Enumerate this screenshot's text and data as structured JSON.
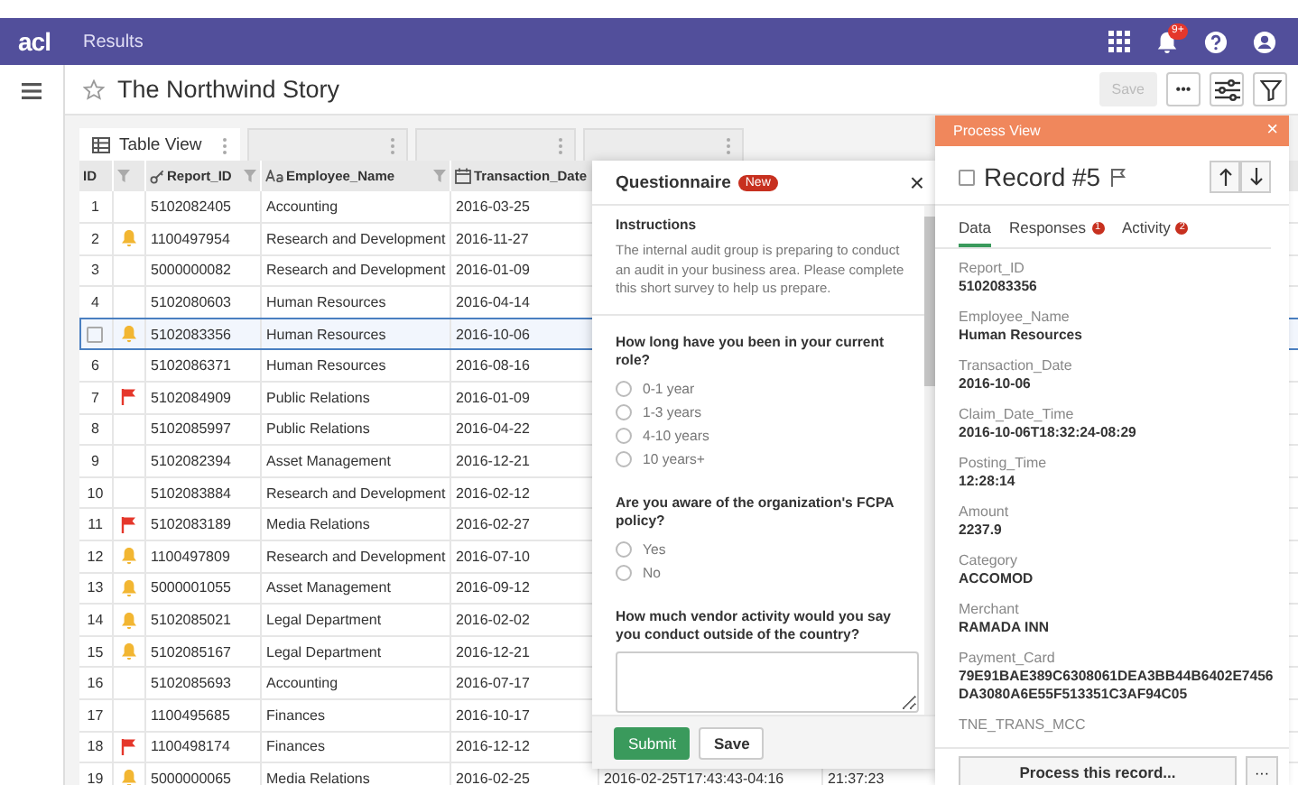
{
  "app_bar": {
    "logo": "acl",
    "title": "Results",
    "notification_badge": "9+"
  },
  "page": {
    "title": "The Northwind Story",
    "save_label": "Save",
    "save_disabled": true,
    "more_label": "•••"
  },
  "tabs": [
    {
      "label": "Table View",
      "selected": true
    },
    {
      "selected": false
    },
    {
      "selected": false
    },
    {
      "selected": false
    }
  ],
  "table": {
    "columns": [
      {
        "label": "ID",
        "kind": "id"
      },
      {
        "kind": "marker"
      },
      {
        "label": "Report_ID",
        "kind": "key"
      },
      {
        "label": "Employee_Name",
        "kind": "text"
      },
      {
        "label": "Transaction_Date",
        "kind": "date"
      }
    ],
    "rows": [
      {
        "selected": false,
        "cells": [
          "1",
          "",
          "5102082405",
          "Accounting",
          "2016-03-25"
        ]
      },
      {
        "kind": "bell",
        "selected": false,
        "cells": [
          "2",
          "",
          "1100497954",
          "Research and Development",
          "2016-11-27"
        ]
      },
      {
        "selected": false,
        "cells": [
          "3",
          "",
          "5000000082",
          "Research and Development",
          "2016-01-09"
        ]
      },
      {
        "selected": false,
        "cells": [
          "4",
          "",
          "5102080603",
          "Human Resources",
          "2016-04-14"
        ]
      },
      {
        "kind": "bell",
        "selected": true,
        "cells": [
          "",
          "",
          "5102083356",
          "Human Resources",
          "2016-10-06"
        ]
      },
      {
        "selected": false,
        "cells": [
          "6",
          "",
          "5102086371",
          "Human Resources",
          "2016-08-16"
        ]
      },
      {
        "kind": "flag",
        "selected": false,
        "cells": [
          "7",
          "",
          "5102084909",
          "Public Relations",
          "2016-01-09"
        ]
      },
      {
        "selected": false,
        "cells": [
          "8",
          "",
          "5102085997",
          "Public Relations",
          "2016-04-22"
        ]
      },
      {
        "selected": false,
        "cells": [
          "9",
          "",
          "5102082394",
          "Asset Management",
          "2016-12-21"
        ]
      },
      {
        "selected": false,
        "cells": [
          "10",
          "",
          "5102083884",
          "Research and Development",
          "2016-02-12"
        ]
      },
      {
        "kind": "flag",
        "selected": false,
        "cells": [
          "11",
          "",
          "5102083189",
          "Media Relations",
          "2016-02-27"
        ]
      },
      {
        "kind": "bell",
        "selected": false,
        "cells": [
          "12",
          "",
          "1100497809",
          "Research and Development",
          "2016-07-10"
        ]
      },
      {
        "kind": "bell",
        "selected": false,
        "cells": [
          "13",
          "",
          "5000001055",
          "Asset Management",
          "2016-09-12"
        ]
      },
      {
        "kind": "bell",
        "selected": false,
        "cells": [
          "14",
          "",
          "5102085021",
          "Legal Department",
          "2016-02-02"
        ]
      },
      {
        "kind": "bell",
        "selected": false,
        "cells": [
          "15",
          "",
          "5102085167",
          "Legal Department",
          "2016-12-21"
        ]
      },
      {
        "selected": false,
        "cells": [
          "16",
          "",
          "5102085693",
          "Accounting",
          "2016-07-17"
        ]
      },
      {
        "selected": false,
        "cells": [
          "17",
          "",
          "1100495685",
          "Finances",
          "2016-10-17"
        ]
      },
      {
        "kind": "flag",
        "selected": false,
        "cells": [
          "18",
          "",
          "1100498174",
          "Finances",
          "2016-12-12"
        ]
      },
      {
        "kind": "bell",
        "selected": false,
        "cells": [
          "19",
          "",
          "5000000065",
          "Media Relations",
          "2016-02-25",
          "2016-02-25T17:43:43-04:16",
          "21:37:23"
        ]
      }
    ]
  },
  "questionnaire": {
    "title": "Questionnaire",
    "badge": "New",
    "close": "×",
    "instructions": {
      "title": "Instructions",
      "text": "The internal audit group is preparing to conduct an audit in your business area. Please complete this short survey to help us prepare."
    },
    "questions": [
      {
        "kind": "radio",
        "text": "How long have you been in your current role?",
        "options": [
          {
            "label": "0-1 year",
            "selected": false
          },
          {
            "label": "1-3 years",
            "selected": false
          },
          {
            "label": "4-10 years",
            "selected": false
          },
          {
            "label": "10 years+",
            "selected": false
          }
        ]
      },
      {
        "kind": "radio",
        "text": "Are you aware of the organization's FCPA policy?",
        "options": [
          {
            "label": "Yes",
            "selected": false
          },
          {
            "label": "No",
            "selected": false
          }
        ]
      },
      {
        "kind": "text",
        "text": "How much vendor activity would you say you conduct outside of the country?"
      }
    ],
    "buttons": [
      {
        "label": "Submit",
        "kind": "primary"
      },
      {
        "label": "Save",
        "kind": "secondary"
      }
    ]
  },
  "process_view": {
    "title": "Process View",
    "close": "×",
    "record_title": "Record #5",
    "checked": false,
    "tabs": [
      {
        "label": "Data",
        "selected": true
      },
      {
        "label": "Responses",
        "selected": false,
        "badge": "1"
      },
      {
        "label": "Activity",
        "selected": false,
        "badge": "2"
      }
    ],
    "fields": [
      {
        "label": "Report_ID",
        "value": "5102083356"
      },
      {
        "label": "Employee_Name",
        "value": "Human Resources"
      },
      {
        "label": "Transaction_Date",
        "value": "2016-10-06"
      },
      {
        "label": "Claim_Date_Time",
        "value": "2016-10-06T18:32:24-08:29"
      },
      {
        "label": "Posting_Time",
        "value": "12:28:14"
      },
      {
        "label": "Amount",
        "value": "2237.9"
      },
      {
        "label": "Category",
        "value": "ACCOMOD"
      },
      {
        "label": "Merchant",
        "value": "RAMADA INN"
      },
      {
        "label": "Payment_Card",
        "value": "79E91BAE389C6308061DEA3BB44B6402E7456DA3080A6E55F513351C3AF94C05"
      },
      {
        "label": "TNE_TRANS_MCC"
      }
    ],
    "process_button": "Process this record...",
    "more_button": "···"
  }
}
